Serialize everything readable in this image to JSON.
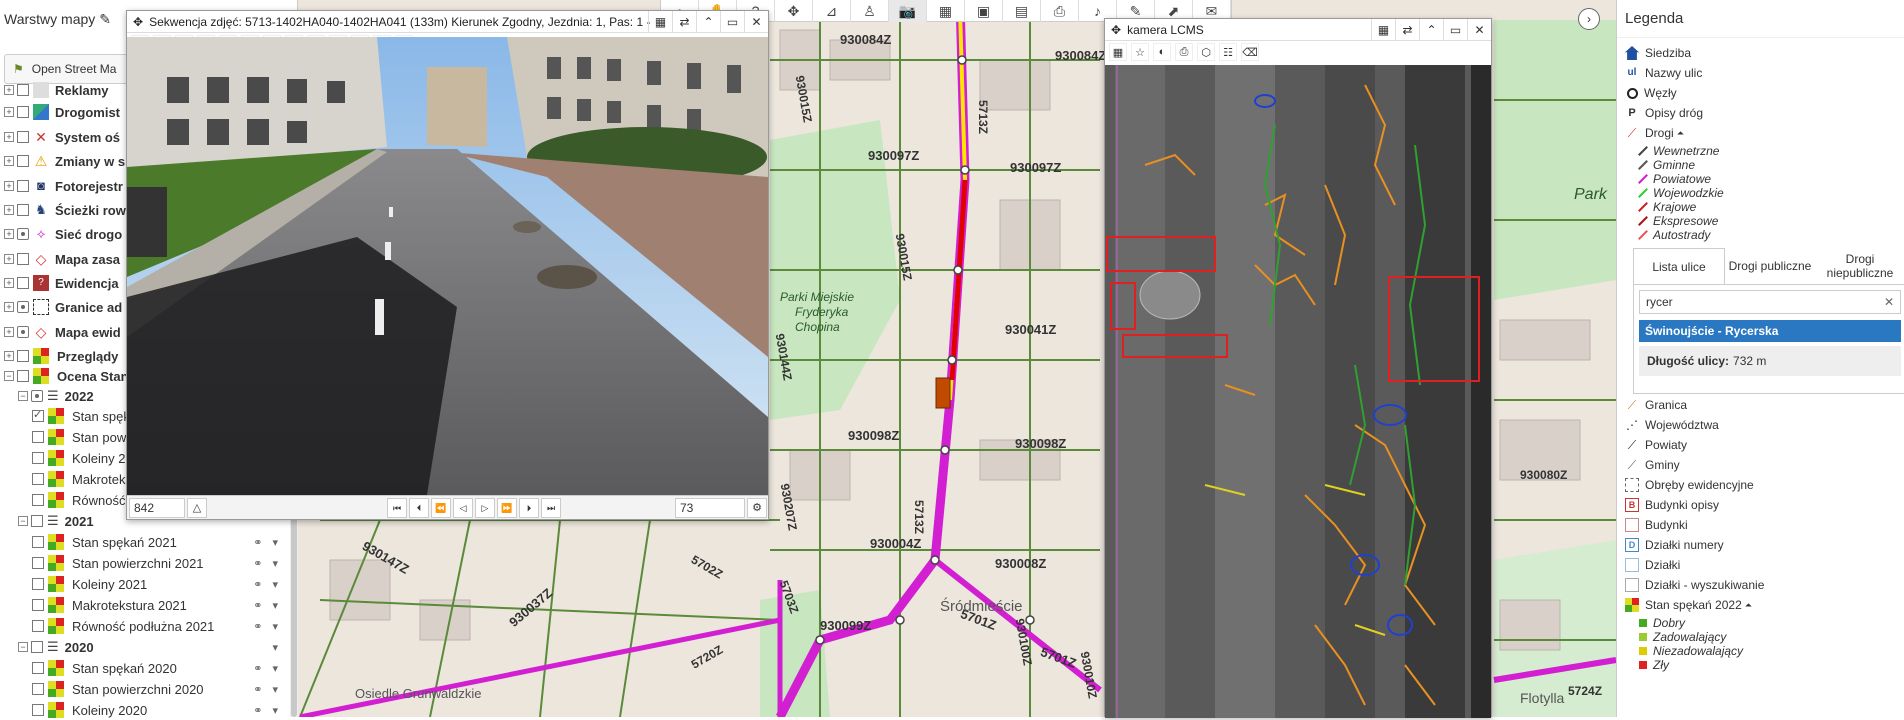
{
  "layers_panel": {
    "title": "Warstwy mapy",
    "basemap_button": "Open Street Ma",
    "items": [
      {
        "label": "Reklamy",
        "bold": true
      },
      {
        "label": "Drogomist",
        "bold": true
      },
      {
        "label": "System oś",
        "bold": true
      },
      {
        "label": "Zmiany w s",
        "bold": true
      },
      {
        "label": "Fotorejestr",
        "bold": true
      },
      {
        "label": "Ścieżki row",
        "bold": true
      },
      {
        "label": "Sieć drogo",
        "bold": true
      },
      {
        "label": "Mapa zasa",
        "bold": true
      },
      {
        "label": "Ewidencja",
        "bold": true
      },
      {
        "label": "Granice ad",
        "bold": true
      },
      {
        "label": "Mapa ewid",
        "bold": true
      },
      {
        "label": "Przeglądy",
        "bold": true
      },
      {
        "label": "Ocena Stan",
        "bold": true
      }
    ],
    "groups": [
      {
        "year": "2022",
        "children": [
          "Stan spęka",
          "Stan powi",
          "Koleiny 20",
          "Makroteks",
          "Równość"
        ]
      },
      {
        "year": "2021",
        "children": [
          "Stan spękań 2021",
          "Stan powierzchni 2021",
          "Koleiny 2021",
          "Makrotekstura 2021",
          "Równość podłużna 2021"
        ]
      },
      {
        "year": "2020",
        "children": [
          "Stan spękań 2020",
          "Stan powierzchni 2020",
          "Koleiny 2020"
        ]
      }
    ]
  },
  "photo_window": {
    "title": "Sekwencja zdjęć: 5713-1402HA040-1402HA041 (133m) Kierunek Zgodny, Jezdnia: 1, Pas: 1 -",
    "frame_input": "842",
    "frame_right": "73"
  },
  "lcms_window": {
    "title": "kamera LCMS"
  },
  "map_labels": [
    "930084Z",
    "930084Z",
    "930015Z",
    "5713Z",
    "930097Z",
    "930097Z",
    "Parki Miejskie",
    "Fryderyka",
    "Chopina",
    "930015Z",
    "930041Z",
    "930144Z",
    "930098Z",
    "930098Z",
    "930004Z",
    "930008Z",
    "930207Z",
    "930100Z",
    "5713Z",
    "5703Z",
    "5702Z",
    "930099Z",
    "5701Z",
    "5720Z",
    "930037Z",
    "930147Z",
    "Śródmieście",
    "Osiedle Grunwaldzkie",
    "5701Z",
    "930010Z",
    "Park",
    "Flotylla",
    "5724Z",
    "930080Z"
  ],
  "legend": {
    "title": "Legenda",
    "items_top": [
      "Siedziba",
      "Nazwy ulic",
      "Węzły",
      "Opisy dróg",
      "Drogi"
    ],
    "roads": [
      {
        "label": "Wewnetrzne",
        "color": "#444444"
      },
      {
        "label": "Gminne",
        "color": "#555555"
      },
      {
        "label": "Powiatowe",
        "color": "#d21fd2"
      },
      {
        "label": "Wojewodzkie",
        "color": "#33cc33"
      },
      {
        "label": "Krajowe",
        "color": "#cc2222"
      },
      {
        "label": "Ekspresowe",
        "color": "#aa1111"
      },
      {
        "label": "Autostrady",
        "color": "#ee5555"
      }
    ],
    "tabs": [
      "Lista ulice",
      "Drogi publiczne",
      "Drogi niepubliczne"
    ],
    "search_value": "rycer",
    "result": "Świnoujście - Rycerska",
    "length_label": "Długość ulicy:",
    "length_value": "732 m",
    "items_bottom": [
      "Granica",
      "Województwa",
      "Powiaty",
      "Gminy",
      "Obręby ewidencyjne",
      "Budynki opisy",
      "Budynki",
      "Działki numery",
      "Działki",
      "Działki - wyszukiwanie",
      "Stan spękań 2022"
    ],
    "crack_classes": [
      {
        "label": "Dobry",
        "color": "#44aa22"
      },
      {
        "label": "Zadowalający",
        "color": "#99cc33"
      },
      {
        "label": "Niezadowalający",
        "color": "#ddcc00"
      },
      {
        "label": "Zły",
        "color": "#dd2222"
      }
    ]
  }
}
